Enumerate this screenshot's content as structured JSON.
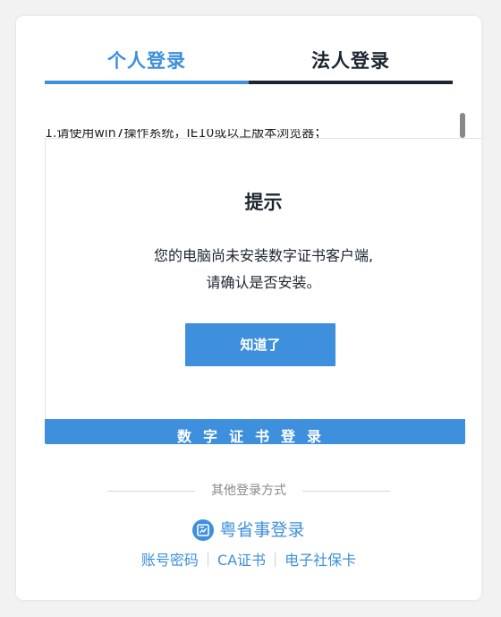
{
  "tabs": {
    "personal_label": "个人登录",
    "legal_label": "法人登录"
  },
  "content": {
    "partial_text": "1.请使用win7操作系统，IE10或以上版本浏览器；"
  },
  "cert_login": {
    "label": "数字证书登录"
  },
  "modal": {
    "title": "提示",
    "message_line1": "您的电脑尚未安装数字证书客户端,",
    "message_line2": "请确认是否安装。",
    "ok_label": "知道了"
  },
  "other_login": {
    "label": "其他登录方式",
    "yss_label": "粤省事登录",
    "yss_icon": "yuesheng-shi-icon",
    "links": [
      "账号密码",
      "CA证书",
      "电子社保卡"
    ]
  },
  "colors": {
    "accent": "#3e8fdc",
    "dark": "#1d2530",
    "muted": "#8a8a8a"
  }
}
